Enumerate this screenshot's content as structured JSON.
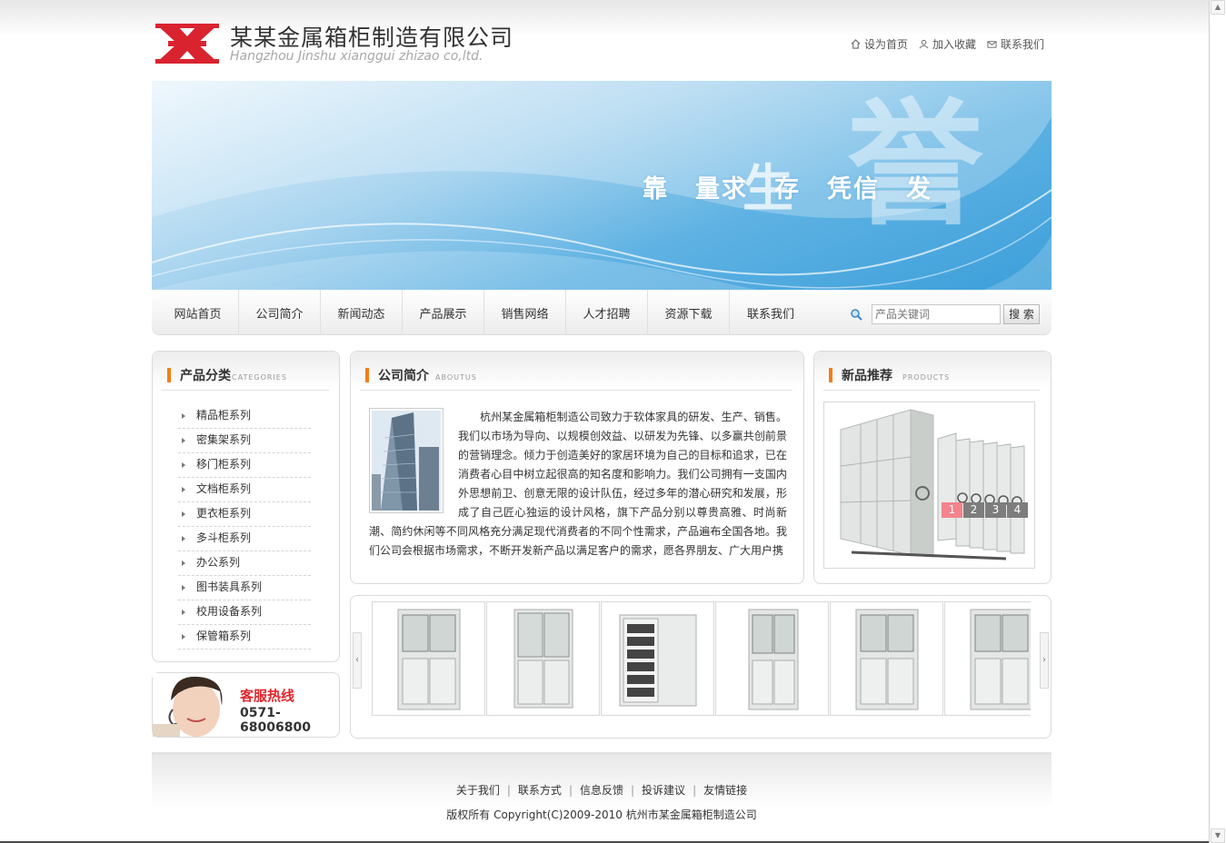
{
  "header": {
    "company_cn": "某某金属箱柜制造有限公司",
    "company_en": "Hangzhou Jinshu xianggui zhizao co,ltd.",
    "links": [
      "设为首页",
      "加入收藏",
      "联系我们"
    ]
  },
  "banner": {
    "slogan": "靠　量求　存　凭信　发",
    "mid_char": "生",
    "big_char": "誉"
  },
  "nav": {
    "items": [
      "网站首页",
      "公司简介",
      "新闻动态",
      "产品展示",
      "销售网络",
      "人才招聘",
      "资源下载",
      "联系我们"
    ],
    "search_placeholder": "产品关键词",
    "search_button": "搜 索"
  },
  "categories": {
    "title": "产品分类",
    "title_en": "CATEGORIES",
    "items": [
      "精品柜系列",
      "密集架系列",
      "移门柜系列",
      "文档柜系列",
      "更衣柜系列",
      "多斗柜系列",
      "办公系列",
      "图书装具系列",
      "校用设备系列",
      "保管箱系列"
    ]
  },
  "hotline": {
    "title": "客服热线",
    "phone": "0571-68006800"
  },
  "about": {
    "title": "公司简介",
    "title_en": "ABOUTUS",
    "text": "杭州某金属箱柜制造公司致力于软体家具的研发、生产、销售。我们以市场为导向、以规模创效益、以研发为先锋、以多赢共创前景的营销理念。倾力于创造美好的家居环境为自己的目标和追求，已在消费者心目中树立起很高的知名度和影响力。我们公司拥有一支国内外思想前卫、创意无限的设计队伍，经过多年的潜心研究和发展，形成了自己匠心独运的设计风格，旗下产品分别以尊贵高雅、时尚新潮、简约休闲等不同风格充分满足现代消费者的不同个性需求，产品遍布全国各地。我们公司会根据市场需求，不断开发新产品以满足客户的需求，愿各界朋友、广大用户携"
  },
  "products": {
    "title": "新品推荐",
    "title_en": "PRODUCTS",
    "pages": [
      "1",
      "2",
      "3",
      "4"
    ],
    "active_page": "1"
  },
  "slider": {
    "left_arrow": "‹",
    "right_arrow": "›"
  },
  "footer": {
    "links": [
      "关于我们",
      "联系方式",
      "信息反馈",
      "投诉建议",
      "友情链接"
    ],
    "separator": "|",
    "copyright": "版权所有  Copyright(C)2009-2010 杭州市某金属箱柜制造公司"
  },
  "colors": {
    "accent_orange": "#f07f1a",
    "logo_red": "#d9232f",
    "hotline_red": "#e0262c",
    "pager_active": "#f3838c",
    "banner_blue": "#3c9fda"
  }
}
